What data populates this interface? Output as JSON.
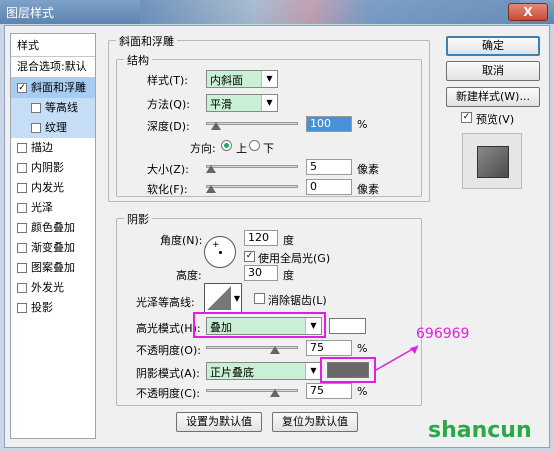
{
  "window": {
    "title": "图层样式",
    "close_label": "X"
  },
  "sidebar": {
    "header": "样式",
    "blend_default": "混合选项:默认",
    "items": [
      {
        "label": "斜面和浮雕",
        "checked": true
      },
      {
        "label": "等高线",
        "checked": false
      },
      {
        "label": "纹理",
        "checked": false
      },
      {
        "label": "描边",
        "checked": false
      },
      {
        "label": "内阴影",
        "checked": false
      },
      {
        "label": "内发光",
        "checked": false
      },
      {
        "label": "光泽",
        "checked": false
      },
      {
        "label": "颜色叠加",
        "checked": false
      },
      {
        "label": "渐变叠加",
        "checked": false
      },
      {
        "label": "图案叠加",
        "checked": false
      },
      {
        "label": "外发光",
        "checked": false
      },
      {
        "label": "投影",
        "checked": false
      }
    ],
    "check_mark": "✓"
  },
  "bevel": {
    "group_title": "斜面和浮雕",
    "structure_title": "结构",
    "style_label": "样式(T):",
    "style_value": "内斜面",
    "technique_label": "方法(Q):",
    "technique_value": "平滑",
    "depth_label": "深度(D):",
    "depth_value": "100",
    "depth_unit": "%",
    "direction_label": "方向:",
    "dir_up": "上",
    "dir_down": "下",
    "size_label": "大小(Z):",
    "size_value": "5",
    "size_unit": "像素",
    "soften_label": "软化(F):",
    "soften_value": "0",
    "soften_unit": "像素"
  },
  "shading": {
    "title": "阴影",
    "angle_label": "角度(N):",
    "angle_value": "120",
    "angle_unit": "度",
    "global_light_label": "使用全局光(G)",
    "global_light_checked": true,
    "altitude_label": "高度:",
    "altitude_value": "30",
    "altitude_unit": "度",
    "gloss_contour_label": "光泽等高线:",
    "anti_alias_label": "消除锯齿(L)",
    "anti_alias_checked": false,
    "highlight_mode_label": "高光模式(H):",
    "highlight_mode_value": "叠加",
    "highlight_color": "#ffffff",
    "highlight_opacity_label": "不透明度(O):",
    "highlight_opacity_value": "75",
    "highlight_opacity_unit": "%",
    "shadow_mode_label": "阴影模式(A):",
    "shadow_mode_value": "正片叠底",
    "shadow_color": "#696969",
    "shadow_opacity_label": "不透明度(C):",
    "shadow_opacity_value": "75",
    "shadow_opacity_unit": "%"
  },
  "footer": {
    "make_default": "设置为默认值",
    "reset_default": "复位为默认值"
  },
  "actions": {
    "ok": "确定",
    "cancel": "取消",
    "new_style": "新建样式(W)...",
    "preview_label": "预览(V)",
    "preview_checked": true
  },
  "annotation": {
    "text": "696969"
  },
  "watermark": {
    "text": "shancun"
  },
  "colors": {
    "accent_magenta": "#e020e0",
    "list_highlight": "#a9cdf2",
    "dropdown_green": "#c9f0d5"
  }
}
